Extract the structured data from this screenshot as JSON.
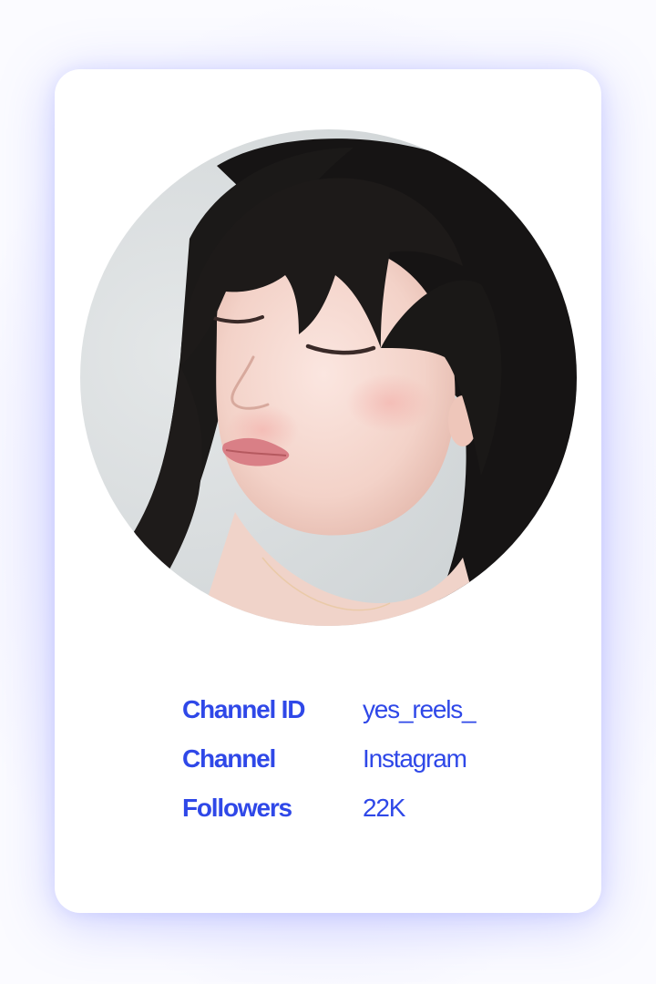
{
  "colors": {
    "accent": "#2f48e8",
    "card_background": "#ffffff",
    "page_glow": "#c9ccff"
  },
  "profile": {
    "photo_alt": "Profile photo of a young woman with dark shoulder-length hair and bangs",
    "fields": [
      {
        "label": "Channel ID",
        "value": "yes_reels_"
      },
      {
        "label": "Channel",
        "value": "Instagram"
      },
      {
        "label": "Followers",
        "value": "22K"
      }
    ]
  }
}
